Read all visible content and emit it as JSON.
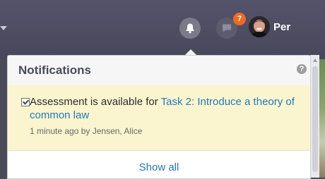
{
  "topbar": {
    "username": "Per",
    "chat_badge_count": "7",
    "icons": [
      "chevron-down-icon",
      "bell-icon",
      "chat-icon",
      "avatar"
    ]
  },
  "notifications": {
    "title": "Notifications",
    "help_icon": "?",
    "items": [
      {
        "text_prefix": "Assessment is available for",
        "link_text": "Task 2: Introduce a theory of common law",
        "meta": "1 minute ago by Jensen, Alice",
        "checked": true
      }
    ],
    "show_all_label": "Show all"
  },
  "colors": {
    "topbar_bg": "#4b4a59",
    "badge": "#f06a21",
    "link": "#1f7ab8",
    "highlight_bg": "#fbf5cf"
  }
}
